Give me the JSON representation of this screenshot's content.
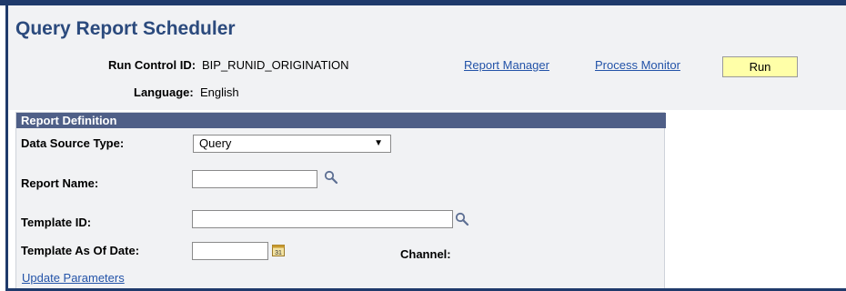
{
  "page": {
    "title": "Query Report Scheduler"
  },
  "header": {
    "run_control_label": "Run Control ID:",
    "run_control_value": "BIP_RUNID_ORIGINATION",
    "language_label": "Language:",
    "language_value": "English",
    "report_manager_link": "Report Manager",
    "process_monitor_link": "Process Monitor",
    "run_button": "Run"
  },
  "report_definition": {
    "section_title": "Report Definition",
    "data_source_type_label": "Data Source Type:",
    "data_source_type_value": "Query",
    "report_name_label": "Report Name:",
    "report_name_value": "",
    "template_id_label": "Template ID:",
    "template_id_value": "",
    "template_as_of_date_label": "Template As Of Date:",
    "template_as_of_date_value": "",
    "channel_label": "Channel:",
    "update_parameters_link": "Update Parameters"
  },
  "icons": {
    "lookup": "magnifier-icon",
    "calendar": "calendar-icon"
  },
  "colors": {
    "title": "#2b4a7d",
    "section_header": "#4f5f87",
    "link": "#2353a8",
    "run_button": "#ffffa8",
    "frame": "#1f3a6b"
  }
}
